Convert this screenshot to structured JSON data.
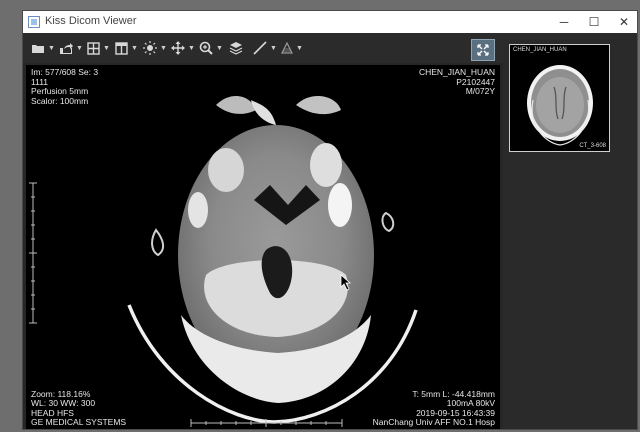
{
  "window": {
    "title": "Kiss Dicom Viewer",
    "controls": [
      "─",
      "☐",
      "✕"
    ]
  },
  "toolbar": {
    "tools": [
      {
        "name": "open-folder-icon"
      },
      {
        "name": "export-icon"
      },
      {
        "name": "layout-grid-icon"
      },
      {
        "name": "series-layout-icon"
      },
      {
        "name": "brightness-icon"
      },
      {
        "name": "pan-icon"
      },
      {
        "name": "zoom-icon"
      },
      {
        "name": "layers-icon"
      },
      {
        "name": "measure-line-icon"
      },
      {
        "name": "annotation-icon"
      }
    ],
    "toggle_icon": "fullscreen-toggle-icon"
  },
  "overlay": {
    "top_left": [
      "Im: 577/608 Se: 3",
      "1111",
      "Perfusion 5mm",
      "Scalor: 100mm"
    ],
    "top_right": [
      "CHEN_JIAN_HUAN",
      "P2102447",
      "M/072Y"
    ],
    "bottom_left": [
      "Zoom: 118.16%",
      "WL: 30 WW: 300",
      "HEAD HFS",
      "GE MEDICAL SYSTEMS"
    ],
    "bottom_right": [
      "T: 5mm L: -44.418mm",
      "100mA 80kV",
      "2019-09-15 16:43:39",
      "NanChang Univ AFF NO.1 Hosp"
    ]
  },
  "thumbnail": {
    "patient": "CHEN_JIAN_HUAN",
    "series": "CT_3-608"
  }
}
